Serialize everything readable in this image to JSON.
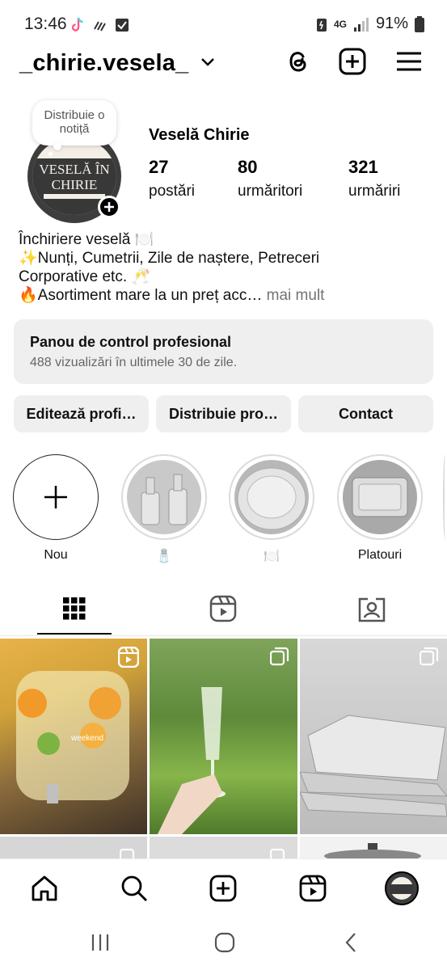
{
  "status_bar": {
    "time": "13:46",
    "network": "4G",
    "battery": "91%"
  },
  "header": {
    "username": "_chirie.vesela_",
    "icons": [
      "threads-icon",
      "create-icon",
      "menu-icon"
    ]
  },
  "profile": {
    "note_prompt": "Distribuie o notiță",
    "display_name": "Veselă Chirie",
    "avatar_text": [
      "VESELĂ ÎN",
      "CHIRIE"
    ],
    "stats": [
      {
        "value": "27",
        "label": "postări"
      },
      {
        "value": "80",
        "label": "urmăritori"
      },
      {
        "value": "321",
        "label": "urmăriri"
      }
    ],
    "bio_lines": [
      "Închiriere veselă 🍽️",
      "✨Nunți, Cumetrii, Zile de naștere, Petreceri",
      "Corporative etc. 🥂",
      "🔥Asortiment mare la un preț acc…"
    ],
    "bio_more": " mai mult"
  },
  "dashboard": {
    "title": "Panou de control profesional",
    "subtitle": "488 vizualizări în ultimele 30 de zile."
  },
  "buttons": {
    "edit": "Editează profi…",
    "share": "Distribuie pro…",
    "contact": "Contact"
  },
  "highlights": [
    {
      "label": "Nou"
    },
    {
      "label": "🧂"
    },
    {
      "label": "🍽️"
    },
    {
      "label": "Platouri"
    }
  ],
  "tabs": [
    "grid-icon",
    "reels-icon",
    "tagged-icon"
  ],
  "grid_captions": {
    "post1": "weekend"
  },
  "colors": {
    "surface": "#efefef",
    "muted": "#737373",
    "avatar_bg": "#3d3d3d"
  }
}
